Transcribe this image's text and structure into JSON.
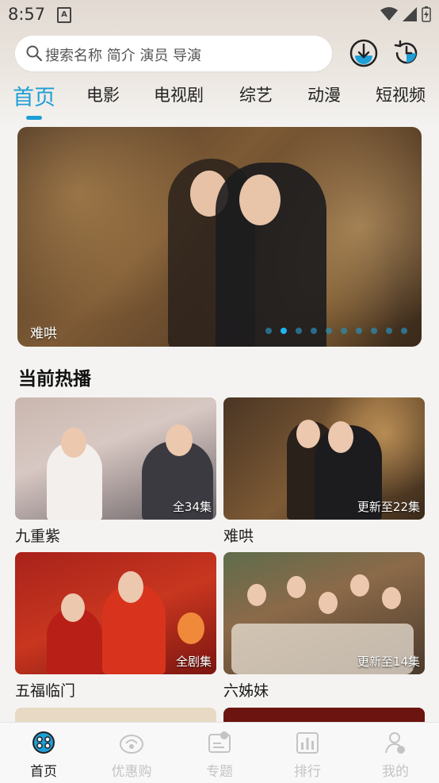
{
  "status_bar": {
    "time": "8:57",
    "notif_icon": "A"
  },
  "search": {
    "placeholder": "搜索名称 简介 演员 导演"
  },
  "header_icons": [
    "download-icon",
    "history-icon"
  ],
  "tabs": [
    {
      "label": "首页",
      "active": true
    },
    {
      "label": "电影"
    },
    {
      "label": "电视剧"
    },
    {
      "label": "综艺"
    },
    {
      "label": "动漫"
    },
    {
      "label": "短视频"
    }
  ],
  "banner": {
    "title": "难哄",
    "slide_count": 10,
    "current_slide": 2
  },
  "section": {
    "title": "当前热播"
  },
  "cards": [
    {
      "name": "九重紫",
      "badge": "全34集"
    },
    {
      "name": "难哄",
      "badge": "更新至22集"
    },
    {
      "name": "五福临门",
      "badge": "全剧集"
    },
    {
      "name": "六姊妹",
      "badge": "更新至14集"
    }
  ],
  "bottom_nav": [
    {
      "label": "首页",
      "icon": "home-icon",
      "active": true
    },
    {
      "label": "优惠购",
      "icon": "shopping-icon"
    },
    {
      "label": "专题",
      "icon": "topic-icon"
    },
    {
      "label": "排行",
      "icon": "ranking-icon"
    },
    {
      "label": "我的",
      "icon": "profile-icon"
    }
  ],
  "colors": {
    "accent": "#1e9fd6",
    "inactive_nav": "#c4c4c4"
  }
}
